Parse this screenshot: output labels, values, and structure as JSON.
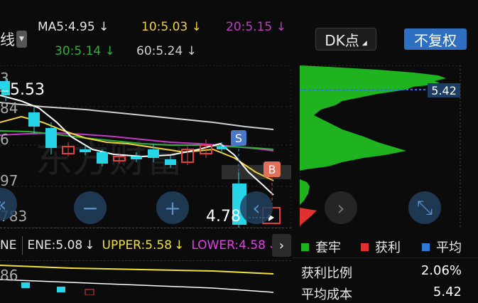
{
  "header": {
    "period_label": "线",
    "ma5": "MA5:4.95",
    "ma10": "10:5.03",
    "ma20": "20:5.15",
    "ma30": "30:5.14",
    "ma60": "60:5.24",
    "down_arrow": "↓",
    "dk_label": "DK点",
    "fq_label": "不复权"
  },
  "chart": {
    "y_labels": [
      "3",
      "84",
      "6",
      "97",
      "783"
    ],
    "high_label": "5.53",
    "last_price": "4.78",
    "sell_badge": "S",
    "buy_badge": "B",
    "watermark": "东方财富"
  },
  "indicator": {
    "name": "NE",
    "ene": "ENE:5.08",
    "upper": "UPPER:5.58",
    "lower": "LOWER:4.58",
    "arrow": "↓",
    "next_icon": "›",
    "sub_y_label": "86"
  },
  "distribution": {
    "avg_price": "5.42"
  },
  "legend": {
    "trapped": "套牢",
    "profit": "获利",
    "average": "平均"
  },
  "stats": {
    "profit_ratio_label": "获利比例",
    "profit_ratio_value": "2.06%",
    "avg_cost_label": "平均成本",
    "avg_cost_value": "5.42"
  },
  "colors": {
    "ma5": "#e6e6e6",
    "ma10": "#f0d23c",
    "ma20": "#c23bc2",
    "ma30": "#2fae3a",
    "ma60": "#cfcfcf",
    "upper": "#f0e03c",
    "lower": "#e040e0",
    "up_candle": "#e04040",
    "down_candle": "#26d6e8",
    "profit_red": "#e03030",
    "trapped_green": "#1fb41f",
    "avg_blue": "#2f78d6"
  }
}
